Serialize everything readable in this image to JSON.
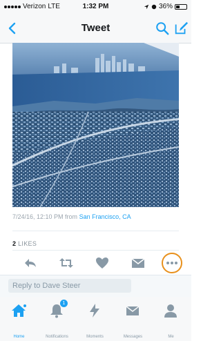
{
  "status_bar": {
    "carrier": "Verizon",
    "network": "LTE",
    "time": "1:32 PM",
    "battery": "36%",
    "battery_level": 0.36
  },
  "nav": {
    "title": "Tweet",
    "back_icon": "chevron-left-icon",
    "search_icon": "search-icon",
    "compose_icon": "compose-icon"
  },
  "tweet": {
    "timestamp": "7/24/16, 12:10 PM from",
    "location": "San Francisco, CA",
    "likes_count": "2",
    "likes_label": "LIKES"
  },
  "actions": [
    {
      "name": "reply",
      "icon": "reply-icon"
    },
    {
      "name": "retweet",
      "icon": "retweet-icon"
    },
    {
      "name": "like",
      "icon": "heart-icon"
    },
    {
      "name": "direct-message",
      "icon": "envelope-icon"
    },
    {
      "name": "more",
      "icon": "more-icon",
      "highlighted": true,
      "highlight_color": "#e8901b"
    }
  ],
  "reply": {
    "placeholder": "Reply to Dave Steer"
  },
  "tabbar": [
    {
      "label": "Home",
      "icon": "home-icon",
      "active": true
    },
    {
      "label": "Notifications",
      "icon": "bell-icon",
      "badge": "1"
    },
    {
      "label": "Moments",
      "icon": "lightning-icon"
    },
    {
      "label": "Messages",
      "icon": "envelope-icon"
    },
    {
      "label": "Me",
      "icon": "person-icon"
    }
  ],
  "colors": {
    "accent": "#1da1f2",
    "highlight": "#e8901b"
  }
}
